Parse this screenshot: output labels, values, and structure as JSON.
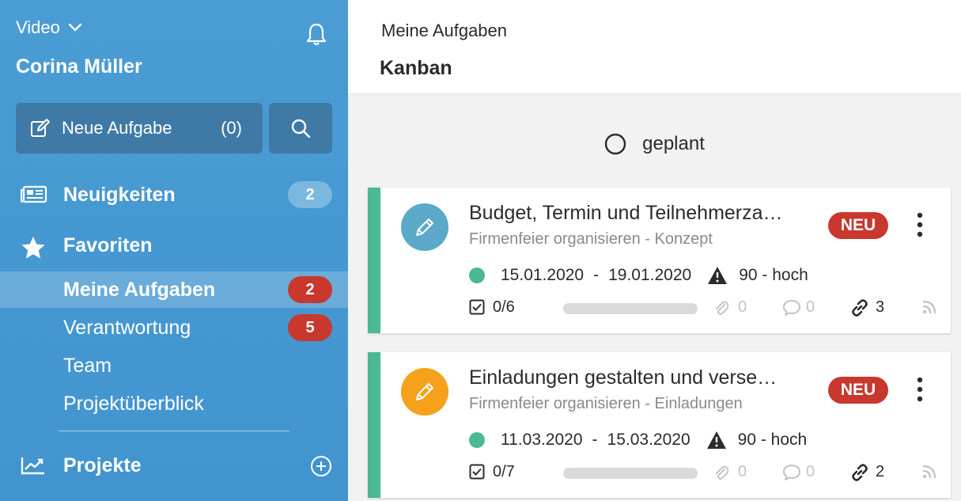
{
  "sidebar": {
    "workspace": "Video",
    "user_name": "Corina Müller",
    "new_task_label": "Neue Aufgabe",
    "new_task_count": "(0)",
    "news": {
      "label": "Neuigkeiten",
      "badge": "2"
    },
    "favorites": {
      "label": "Favoriten"
    },
    "sub_items": [
      {
        "label": "Meine Aufgaben",
        "badge": "2"
      },
      {
        "label": "Verantwortung",
        "badge": "5"
      },
      {
        "label": "Team"
      },
      {
        "label": "Projektüberblick"
      }
    ],
    "projects": {
      "label": "Projekte"
    }
  },
  "header": {
    "breadcrumb": "Meine Aufgaben",
    "title": "Kanban"
  },
  "column": {
    "label": "geplant"
  },
  "cards": [
    {
      "title": "Budget, Termin und Teilnehmerza…",
      "subtitle": "Firmenfeier organisieren - Konzept",
      "badge": "NEU",
      "start": "15.01.2020",
      "dash": "-",
      "end": "19.01.2020",
      "priority": "90 - hoch",
      "checklist": "0/6",
      "progress": 0,
      "attachments": "0",
      "comments": "0",
      "links": "3",
      "avatar_color": "#5aa9c8"
    },
    {
      "title": "Einladungen gestalten und verse…",
      "subtitle": "Firmenfeier organisieren - Einladungen",
      "badge": "NEU",
      "start": "11.03.2020",
      "dash": "-",
      "end": "15.03.2020",
      "priority": "90 - hoch",
      "checklist": "0/7",
      "progress": 0,
      "attachments": "0",
      "comments": "0",
      "links": "2",
      "avatar_color": "#f5a11b"
    }
  ],
  "colors": {
    "sidebar": "#4a9cd4",
    "button": "#3f7aa6",
    "badge_red": "#c8382e",
    "badge_blue": "#7ab8e0",
    "accent_green": "#4cb894"
  }
}
